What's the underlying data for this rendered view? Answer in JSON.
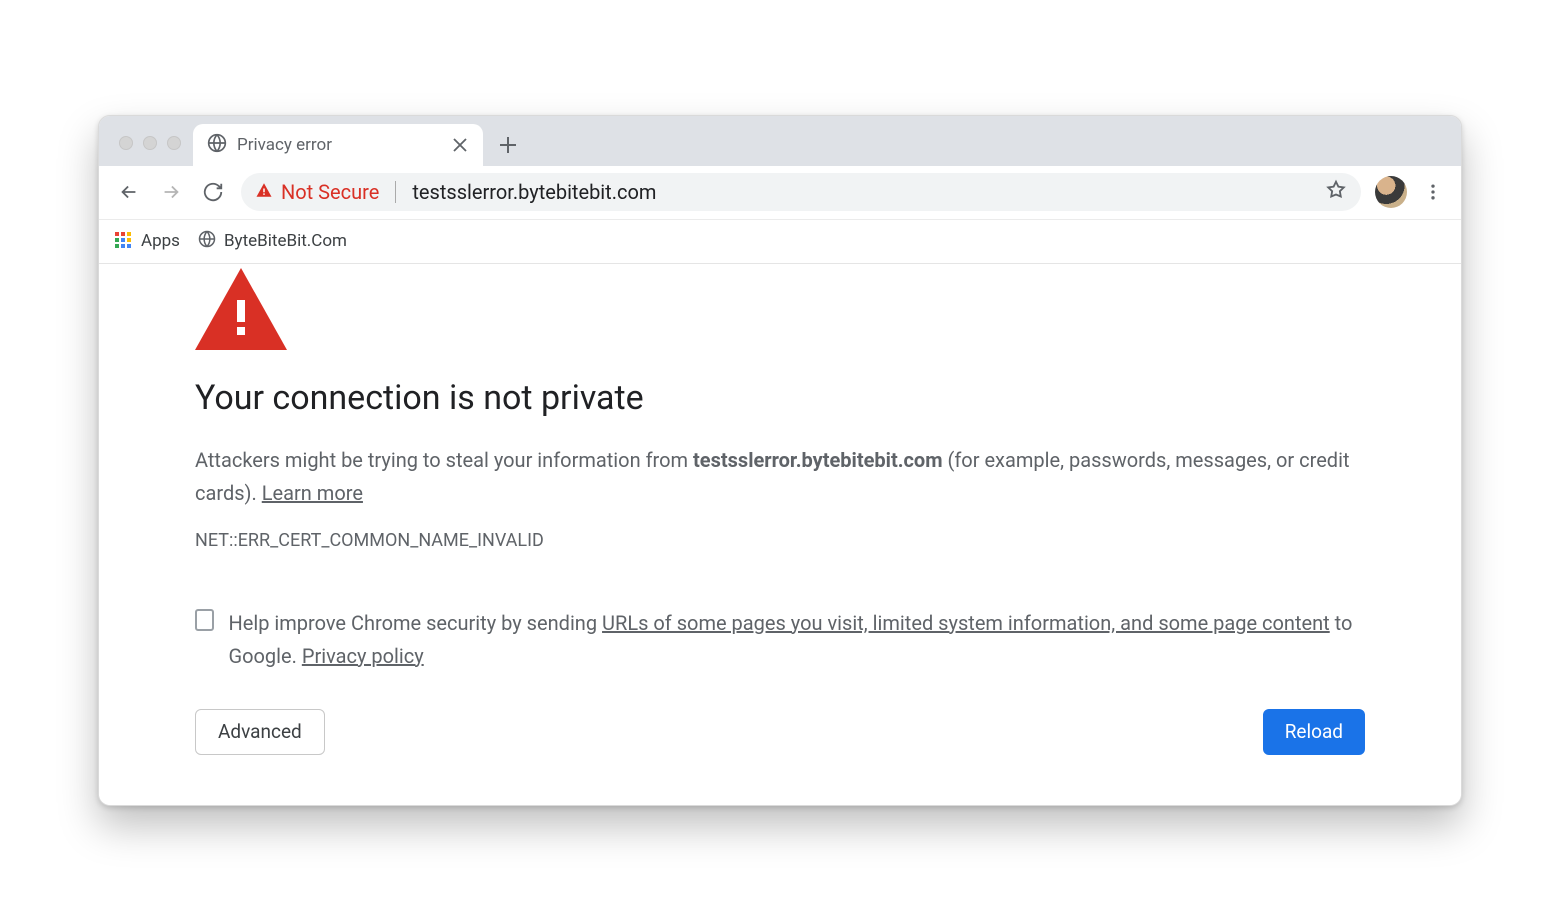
{
  "tab": {
    "title": "Privacy error"
  },
  "address_bar": {
    "security_label": "Not Secure",
    "url": "testsslerror.bytebitebit.com"
  },
  "bookmarks": {
    "apps_label": "Apps",
    "items": [
      {
        "label": "ByteBiteBit.Com"
      }
    ]
  },
  "page": {
    "heading": "Your connection is not private",
    "desc_prefix": "Attackers might be trying to steal your information from ",
    "desc_domain": "testsslerror.bytebitebit.com",
    "desc_suffix": " (for example, passwords, messages, or credit cards). ",
    "learn_more": "Learn more",
    "error_code": "NET::ERR_CERT_COMMON_NAME_INVALID",
    "opt_in_prefix": "Help improve Chrome security by sending ",
    "opt_in_link": "URLs of some pages you visit, limited system information, and some page content",
    "opt_in_suffix": " to Google. ",
    "privacy_policy": "Privacy policy",
    "advanced_btn": "Advanced",
    "reload_btn": "Reload"
  },
  "colors": {
    "danger": "#d93025",
    "primary": "#1a73e8"
  }
}
